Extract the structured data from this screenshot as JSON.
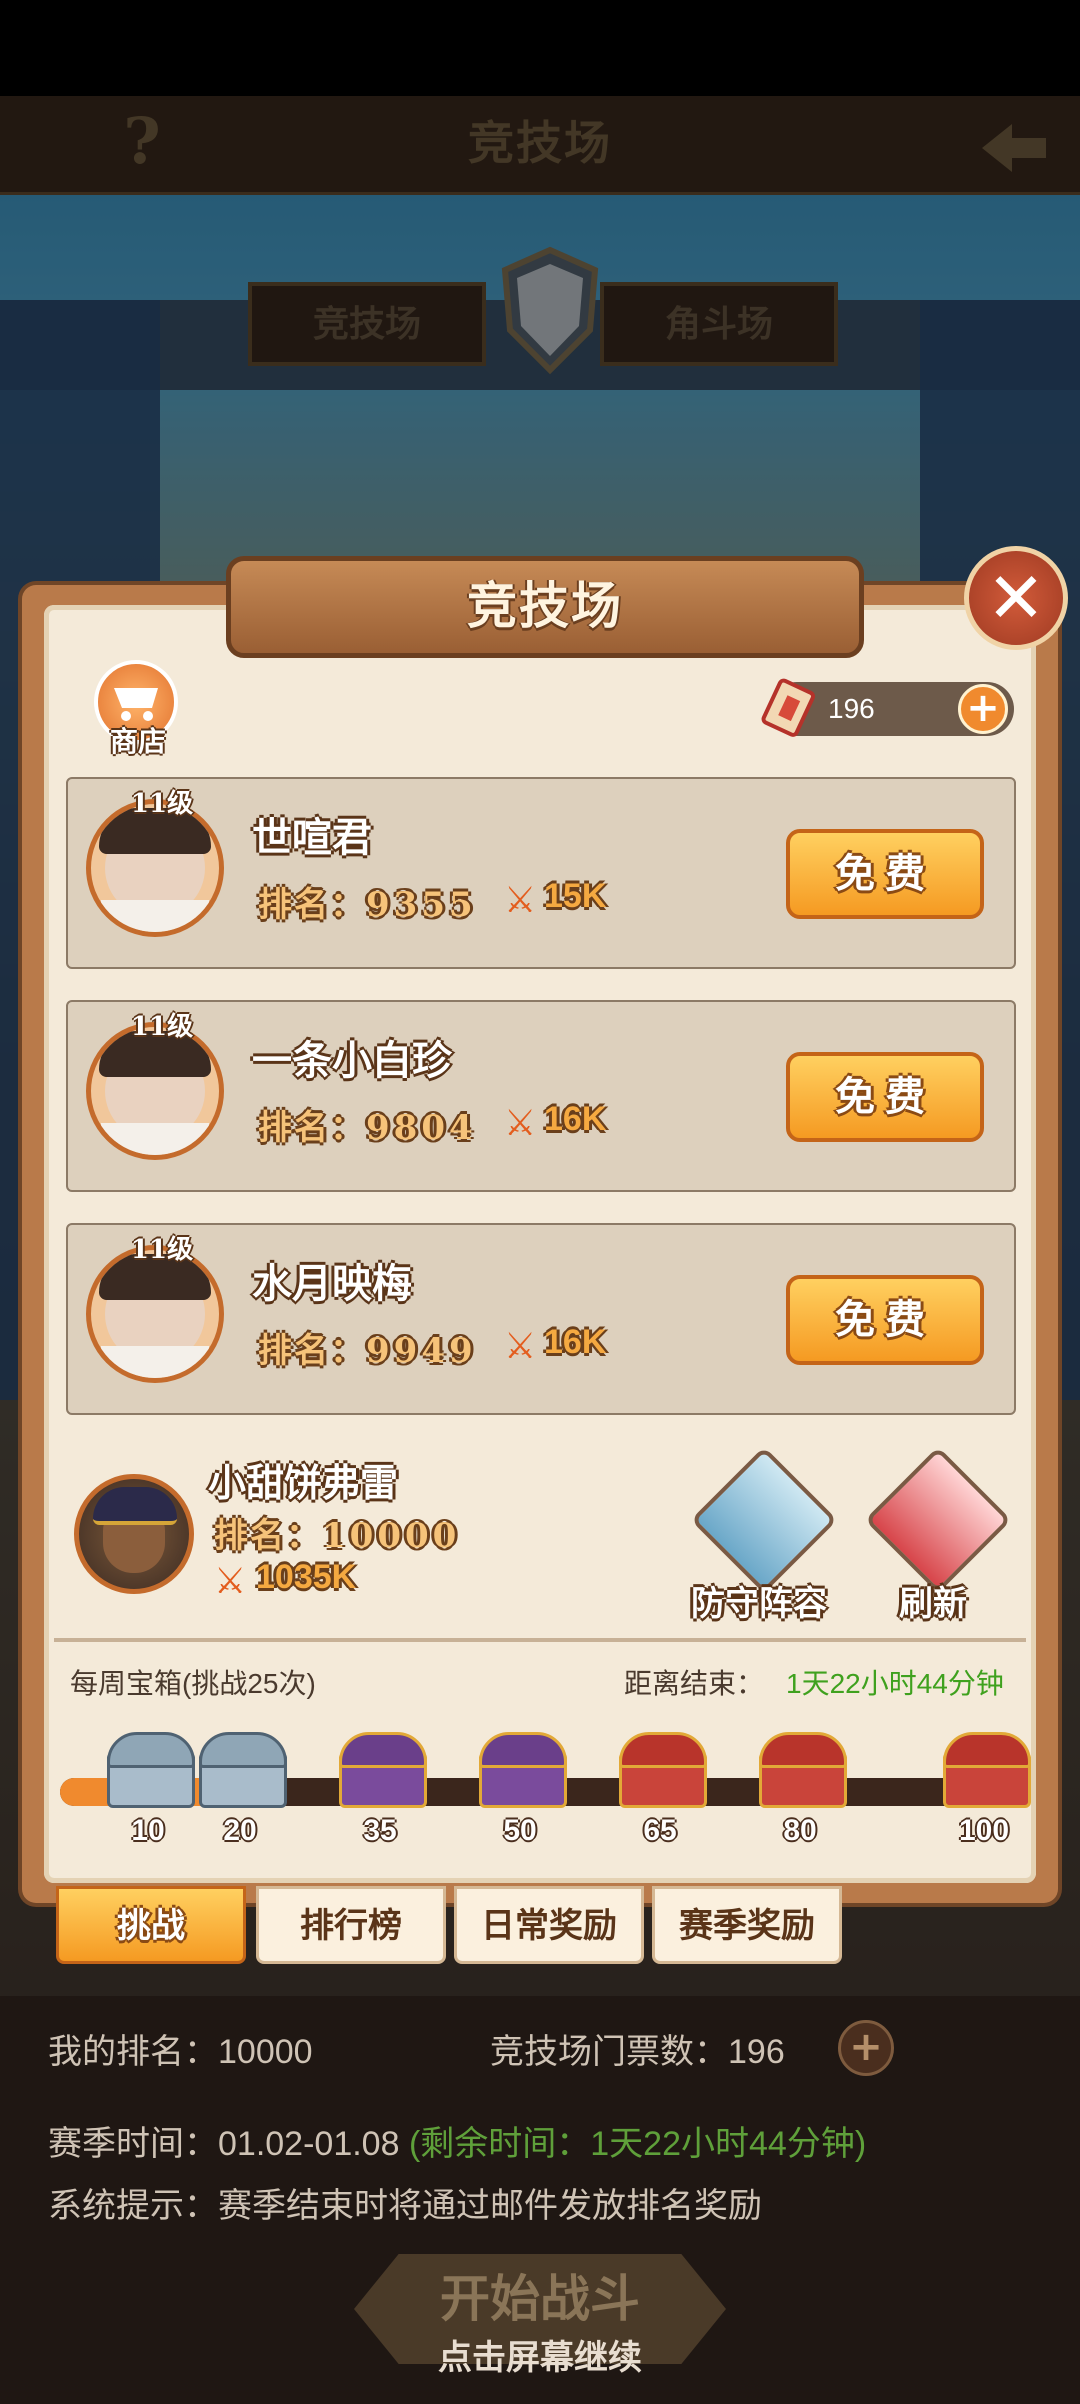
{
  "top_bar": {
    "title": "竞技场",
    "help": "?"
  },
  "modes": {
    "arena": "竞技场",
    "duel": "角斗场"
  },
  "panel": {
    "title": "竞技场"
  },
  "shop": {
    "label": "商店"
  },
  "tickets": {
    "count": "196",
    "add": "+"
  },
  "opponents": [
    {
      "level": "11级",
      "name": "世喧君",
      "rank_label": "排名：",
      "rank": "9355",
      "power": "15K",
      "button": "免费"
    },
    {
      "level": "11级",
      "name": "一条小白珍",
      "rank_label": "排名：",
      "rank": "9804",
      "power": "16K",
      "button": "免费"
    },
    {
      "level": "11级",
      "name": "水月映梅",
      "rank_label": "排名：",
      "rank": "9949",
      "power": "16K",
      "button": "免费"
    }
  ],
  "self": {
    "name": "小甜饼弗雷",
    "rank_label": "排名：",
    "rank": "10000",
    "power": "1035K"
  },
  "actions": {
    "defense": "防守阵容",
    "refresh": "刷新"
  },
  "weekly": {
    "label": "每周宝箱(挑战25次)",
    "countdown_label": "距离结束：",
    "countdown": "1天22小时44分钟",
    "progress_fraction": 0.16,
    "milestones": [
      "10",
      "20",
      "35",
      "50",
      "65",
      "80",
      "100"
    ]
  },
  "tabs": {
    "challenge": "挑战",
    "ranking": "排行榜",
    "daily": "日常奖励",
    "season": "赛季奖励"
  },
  "footer": {
    "my_rank": "我的排名：10000",
    "ticket_info": "竞技场门票数：196",
    "season_time": "赛季时间：01.02-01.08",
    "season_remaining": "(剩余时间：1天22小时44分钟)",
    "system_tip": "系统提示：赛季结束时将通过邮件发放排名奖励",
    "start_button": "开始战斗",
    "continue_hint": "点击屏幕继续"
  },
  "colors": {
    "accent": "#f08a2e",
    "countdown": "#3fa11e",
    "panel": "#f4ead9"
  }
}
